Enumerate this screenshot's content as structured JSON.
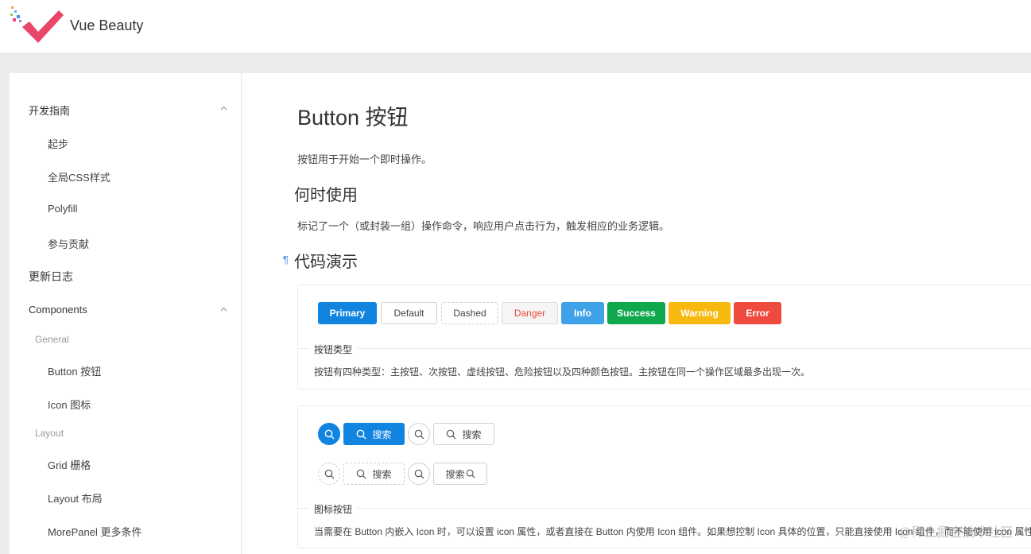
{
  "app": {
    "brand": "Vue Beauty",
    "logo_icon": "checkmark-logo-icon"
  },
  "sidebar": {
    "guide": {
      "label": "开发指南",
      "items": [
        "起步",
        "全局CSS样式",
        "Polyfill",
        "参与贡献"
      ]
    },
    "changelog": "更新日志",
    "components": {
      "label": "Components",
      "categories": [
        {
          "label": "General",
          "items": [
            "Button 按钮",
            "Icon 图标"
          ]
        },
        {
          "label": "Layout",
          "items": [
            "Grid 栅格",
            "Layout 布局",
            "MorePanel 更多条件"
          ]
        }
      ]
    }
  },
  "main": {
    "title": "Button 按钮",
    "description": "按钮用于开始一个即时操作。",
    "when_to_use": {
      "heading": "何时使用",
      "text": "标记了一个（或封装一组）操作命令，响应用户点击行为，触发相应的业务逻辑。"
    },
    "demo_heading": "代码演示",
    "anchor_symbol": "¶",
    "demo1": {
      "buttons": [
        "Primary",
        "Default",
        "Dashed",
        "Danger",
        "Info",
        "Success",
        "Warning",
        "Error"
      ],
      "meta_title": "按钮类型",
      "meta_desc": "按钮有四种类型：主按钮、次按钮、虚线按钮、危险按钮以及四种颜色按钮。主按钮在同一个操作区域最多出现一次。"
    },
    "demo2": {
      "search_label": "搜索",
      "search_suffix_label": "搜索",
      "meta_title": "图标按钮",
      "meta_desc": "当需要在 Button 内嵌入 Icon 时，可以设置 icon 属性，或者直接在 Button 内使用 Icon 组件。如果想控制 Icon 具体的位置，只能直接使用 Icon 组件，而不能使用 icon 属性。"
    }
  },
  "watermark": "@稀土掘金技术社区",
  "colors": {
    "primary": "#1184e0",
    "info": "#3fa2e8",
    "success": "#0fa84c",
    "warning": "#f8b90e",
    "error": "#ee4b3e",
    "danger_text": "#e84a3c",
    "logo_pink": "#e8476a"
  }
}
